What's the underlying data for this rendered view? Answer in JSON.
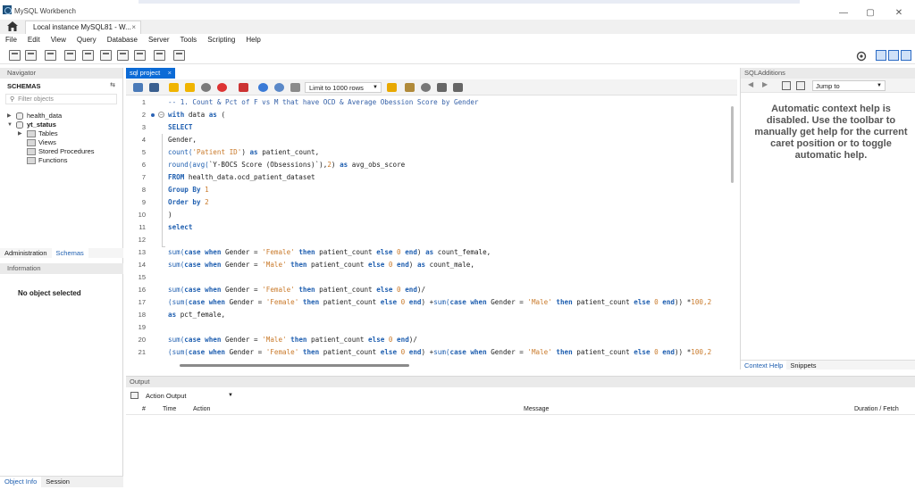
{
  "window": {
    "title": "MySQL Workbench",
    "minimize": "—",
    "maximize": "▢",
    "close": "✕"
  },
  "connection_tab": {
    "label": "Local instance MySQL81 - W...",
    "close": "×"
  },
  "menu": [
    "File",
    "Edit",
    "View",
    "Query",
    "Database",
    "Server",
    "Tools",
    "Scripting",
    "Help"
  ],
  "navigator": {
    "header": "Navigator",
    "schemas_title": "SCHEMAS",
    "filter_placeholder": "Filter objects",
    "tree": [
      {
        "label": "health_data"
      },
      {
        "label": "yt_status"
      },
      {
        "label": "Tables"
      },
      {
        "label": "Views"
      },
      {
        "label": "Stored Procedures"
      },
      {
        "label": "Functions"
      }
    ],
    "sub_tabs": {
      "administration": "Administration",
      "schemas": "Schemas"
    },
    "information_header": "Information",
    "no_object": "No object selected",
    "bottom_tabs": {
      "object_info": "Object Info",
      "session": "Session"
    }
  },
  "editor": {
    "tab_label": "sql project",
    "tab_close": "×",
    "limit_label": "Limit to 1000 rows",
    "lines": [
      {
        "n": "1",
        "segs": [
          {
            "t": "-- 1. Count & Pct of F vs M that have OCD & Average Obession Score by Gender",
            "c": "comment"
          }
        ]
      },
      {
        "n": "2",
        "segs": [
          {
            "t": "with ",
            "c": "kw"
          },
          {
            "t": "data ",
            "c": "plain"
          },
          {
            "t": "as",
            "c": "kw"
          },
          {
            "t": " (",
            "c": "plain"
          }
        ]
      },
      {
        "n": "3",
        "segs": [
          {
            "t": "SELECT",
            "c": "kw"
          }
        ]
      },
      {
        "n": "4",
        "segs": [
          {
            "t": "Gender,",
            "c": "plain"
          }
        ]
      },
      {
        "n": "5",
        "segs": [
          {
            "t": "count(",
            "c": "fn"
          },
          {
            "t": "'Patient ID'",
            "c": "str"
          },
          {
            "t": ") ",
            "c": "plain"
          },
          {
            "t": "as",
            "c": "kw"
          },
          {
            "t": " patient_count,",
            "c": "plain"
          }
        ]
      },
      {
        "n": "6",
        "segs": [
          {
            "t": "round(avg(",
            "c": "fn"
          },
          {
            "t": "`Y-BOCS Score (Obsessions)`",
            "c": "plain"
          },
          {
            "t": "),",
            "c": "plain"
          },
          {
            "t": "2",
            "c": "num"
          },
          {
            "t": ") ",
            "c": "plain"
          },
          {
            "t": "as",
            "c": "kw"
          },
          {
            "t": " avg_obs_score",
            "c": "plain"
          }
        ]
      },
      {
        "n": "7",
        "segs": [
          {
            "t": "FROM",
            "c": "kw"
          },
          {
            "t": " health_data.ocd_patient_dataset",
            "c": "plain"
          }
        ]
      },
      {
        "n": "8",
        "segs": [
          {
            "t": "Group By ",
            "c": "kw"
          },
          {
            "t": "1",
            "c": "num"
          }
        ]
      },
      {
        "n": "9",
        "segs": [
          {
            "t": "Order by ",
            "c": "kw"
          },
          {
            "t": "2",
            "c": "num"
          }
        ]
      },
      {
        "n": "10",
        "segs": [
          {
            "t": ")",
            "c": "plain"
          }
        ]
      },
      {
        "n": "11",
        "segs": [
          {
            "t": "select",
            "c": "kw"
          }
        ]
      },
      {
        "n": "12",
        "segs": []
      },
      {
        "n": "13",
        "segs": [
          {
            "t": "sum(",
            "c": "fn"
          },
          {
            "t": "case when",
            "c": "kw"
          },
          {
            "t": " Gender = ",
            "c": "plain"
          },
          {
            "t": "'Female'",
            "c": "str"
          },
          {
            "t": " then",
            "c": "kw"
          },
          {
            "t": " patient_count ",
            "c": "plain"
          },
          {
            "t": "else ",
            "c": "kw"
          },
          {
            "t": "0",
            "c": "num"
          },
          {
            "t": " end",
            "c": "kw"
          },
          {
            "t": ") ",
            "c": "plain"
          },
          {
            "t": "as",
            "c": "kw"
          },
          {
            "t": " count_female,",
            "c": "plain"
          }
        ]
      },
      {
        "n": "14",
        "segs": [
          {
            "t": "sum(",
            "c": "fn"
          },
          {
            "t": "case when",
            "c": "kw"
          },
          {
            "t": " Gender = ",
            "c": "plain"
          },
          {
            "t": "'Male'",
            "c": "str"
          },
          {
            "t": " then",
            "c": "kw"
          },
          {
            "t": " patient_count ",
            "c": "plain"
          },
          {
            "t": "else ",
            "c": "kw"
          },
          {
            "t": "0",
            "c": "num"
          },
          {
            "t": " end",
            "c": "kw"
          },
          {
            "t": ") ",
            "c": "plain"
          },
          {
            "t": "as",
            "c": "kw"
          },
          {
            "t": " count_male,",
            "c": "plain"
          }
        ]
      },
      {
        "n": "15",
        "segs": []
      },
      {
        "n": "16",
        "segs": [
          {
            "t": "sum(",
            "c": "fn"
          },
          {
            "t": "case when",
            "c": "kw"
          },
          {
            "t": " Gender = ",
            "c": "plain"
          },
          {
            "t": "'Female'",
            "c": "str"
          },
          {
            "t": " then",
            "c": "kw"
          },
          {
            "t": " patient_count ",
            "c": "plain"
          },
          {
            "t": "else ",
            "c": "kw"
          },
          {
            "t": "0",
            "c": "num"
          },
          {
            "t": " end",
            "c": "kw"
          },
          {
            "t": ")/",
            "c": "plain"
          }
        ]
      },
      {
        "n": "17",
        "segs": [
          {
            "t": "(sum(",
            "c": "fn"
          },
          {
            "t": "case when",
            "c": "kw"
          },
          {
            "t": " Gender = ",
            "c": "plain"
          },
          {
            "t": "'Female'",
            "c": "str"
          },
          {
            "t": " then",
            "c": "kw"
          },
          {
            "t": " patient_count ",
            "c": "plain"
          },
          {
            "t": "else ",
            "c": "kw"
          },
          {
            "t": "0",
            "c": "num"
          },
          {
            "t": " end",
            "c": "kw"
          },
          {
            "t": ") +",
            "c": "plain"
          },
          {
            "t": "sum(",
            "c": "fn"
          },
          {
            "t": "case when",
            "c": "kw"
          },
          {
            "t": " Gender = ",
            "c": "plain"
          },
          {
            "t": "'Male'",
            "c": "str"
          },
          {
            "t": " then",
            "c": "kw"
          },
          {
            "t": " patient_count ",
            "c": "plain"
          },
          {
            "t": "else ",
            "c": "kw"
          },
          {
            "t": "0",
            "c": "num"
          },
          {
            "t": " end",
            "c": "kw"
          },
          {
            "t": ")) *",
            "c": "plain"
          },
          {
            "t": "100",
            "c": "num"
          },
          {
            "t": ",2",
            "c": "num"
          }
        ]
      },
      {
        "n": "18",
        "segs": [
          {
            "t": "as",
            "c": "kw"
          },
          {
            "t": " pct_female,",
            "c": "plain"
          }
        ]
      },
      {
        "n": "19",
        "segs": []
      },
      {
        "n": "20",
        "segs": [
          {
            "t": "sum(",
            "c": "fn"
          },
          {
            "t": "case when",
            "c": "kw"
          },
          {
            "t": " Gender = ",
            "c": "plain"
          },
          {
            "t": "'Male'",
            "c": "str"
          },
          {
            "t": " then",
            "c": "kw"
          },
          {
            "t": " patient_count ",
            "c": "plain"
          },
          {
            "t": "else ",
            "c": "kw"
          },
          {
            "t": "0",
            "c": "num"
          },
          {
            "t": " end",
            "c": "kw"
          },
          {
            "t": ")/",
            "c": "plain"
          }
        ]
      },
      {
        "n": "21",
        "segs": [
          {
            "t": "(sum(",
            "c": "fn"
          },
          {
            "t": "case when",
            "c": "kw"
          },
          {
            "t": " Gender = ",
            "c": "plain"
          },
          {
            "t": "'Female'",
            "c": "str"
          },
          {
            "t": " then",
            "c": "kw"
          },
          {
            "t": " patient_count ",
            "c": "plain"
          },
          {
            "t": "else ",
            "c": "kw"
          },
          {
            "t": "0",
            "c": "num"
          },
          {
            "t": " end",
            "c": "kw"
          },
          {
            "t": ") +",
            "c": "plain"
          },
          {
            "t": "sum(",
            "c": "fn"
          },
          {
            "t": "case when",
            "c": "kw"
          },
          {
            "t": " Gender = ",
            "c": "plain"
          },
          {
            "t": "'Male'",
            "c": "str"
          },
          {
            "t": " then",
            "c": "kw"
          },
          {
            "t": " patient_count ",
            "c": "plain"
          },
          {
            "t": "else ",
            "c": "kw"
          },
          {
            "t": "0",
            "c": "num"
          },
          {
            "t": " end",
            "c": "kw"
          },
          {
            "t": ")) *",
            "c": "plain"
          },
          {
            "t": "100",
            "c": "num"
          },
          {
            "t": ",2",
            "c": "num"
          }
        ]
      }
    ]
  },
  "sql_additions": {
    "header": "SQLAdditions",
    "jump_to": "Jump to",
    "help_text": "Automatic context help is disabled. Use the toolbar to manually get help for the current caret position or to toggle automatic help.",
    "tabs": {
      "context_help": "Context Help",
      "snippets": "Snippets"
    }
  },
  "output": {
    "header": "Output",
    "selector": "Action Output",
    "columns": [
      "#",
      "Time",
      "Action",
      "Message",
      "Duration / Fetch"
    ]
  },
  "colors": {
    "accent": "#0c6bd6",
    "comment": "#3561a8",
    "keyword": "#1f5fb0",
    "string": "#c97a2b"
  }
}
